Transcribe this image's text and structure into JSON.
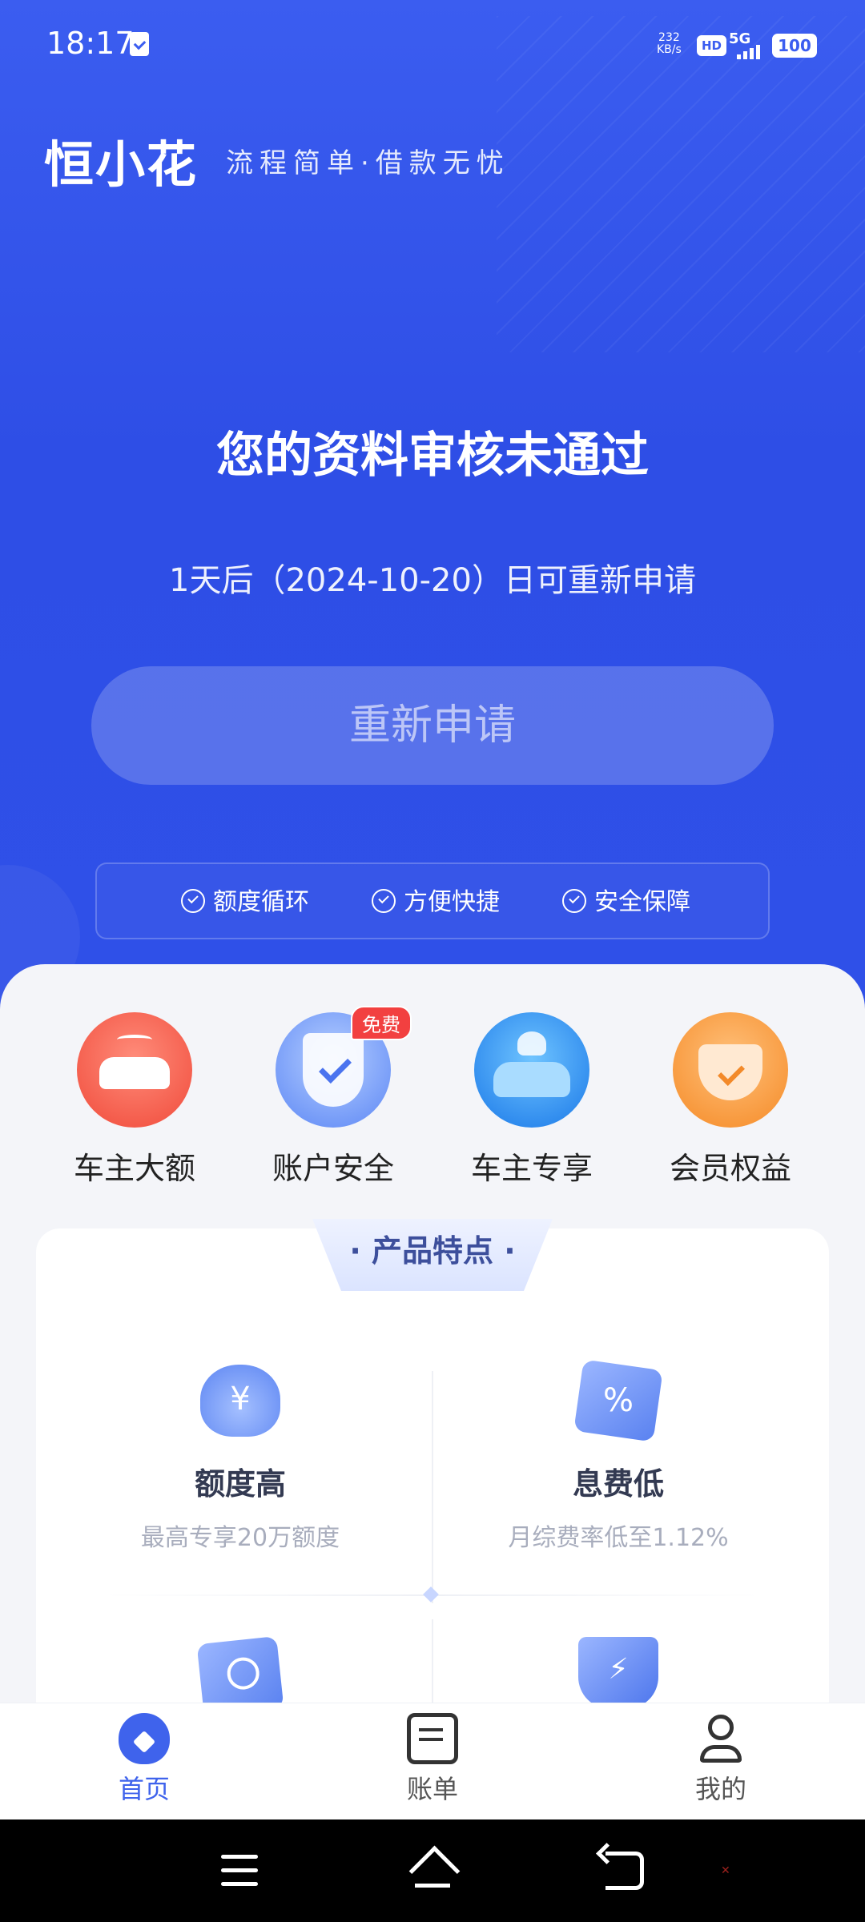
{
  "status_bar": {
    "time": "18:17",
    "net_speed": "232",
    "net_unit": "KB/s",
    "hd": "HD",
    "network": "5G",
    "battery": "100"
  },
  "brand": {
    "logo": "恒小花",
    "slogan": "流程简单·借款无忧"
  },
  "review": {
    "title": "您的资料审核未通过",
    "subtitle": "1天后（2024-10-20）日可重新申请",
    "button": "重新申请"
  },
  "features_strip": [
    "额度循环",
    "方便快捷",
    "安全保障"
  ],
  "shortcuts": [
    {
      "label": "车主大额",
      "icon": "car-icon"
    },
    {
      "label": "账户安全",
      "icon": "shield-check-icon",
      "badge": "免费"
    },
    {
      "label": "车主专享",
      "icon": "car-exclusive-icon"
    },
    {
      "label": "会员权益",
      "icon": "crown-icon"
    }
  ],
  "product": {
    "tab_title": "· 产品特点 ·",
    "items": [
      {
        "title": "额度高",
        "desc": "最高专享20万额度",
        "icon": "money-bag-icon"
      },
      {
        "title": "息费低",
        "desc": "月综费率低至1.12%",
        "icon": "percent-icon"
      },
      {
        "title": "",
        "desc": "",
        "icon": "id-card-icon"
      },
      {
        "title": "",
        "desc": "",
        "icon": "lightning-shield-icon"
      }
    ]
  },
  "tabbar": [
    {
      "label": "首页",
      "icon": "home-icon",
      "active": true
    },
    {
      "label": "账单",
      "icon": "bill-icon",
      "active": false
    },
    {
      "label": "我的",
      "icon": "profile-icon",
      "active": false
    }
  ],
  "colors": {
    "primary": "#3f63ec",
    "hero_bg": "#3b5df0",
    "badge_red": "#f24040"
  }
}
